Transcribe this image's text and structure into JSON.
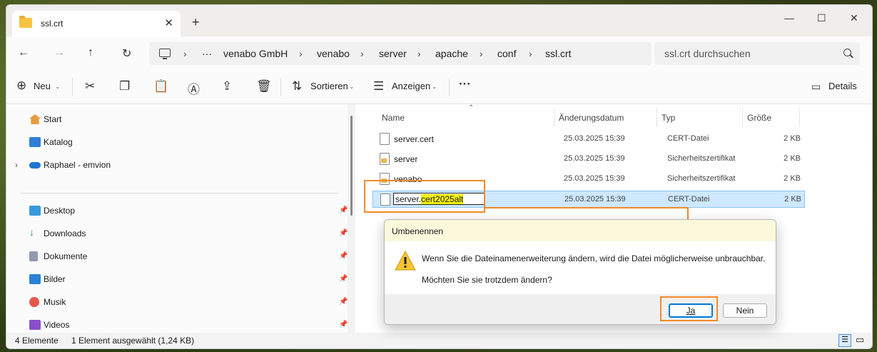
{
  "window": {
    "tab_title": "ssl.crt",
    "close_tab": "✕",
    "new_tab": "+",
    "minimize": "—",
    "maximize": "☐",
    "close": "✕"
  },
  "nav": {
    "back": "←",
    "forward": "→",
    "up": "↑",
    "refresh": "↻",
    "more": "···",
    "breadcrumbs": [
      "venabo GmbH",
      "venabo",
      "server",
      "apache",
      "conf",
      "ssl.crt"
    ],
    "search_placeholder": "ssl.crt durchsuchen"
  },
  "toolbar": {
    "new_label": "Neu",
    "sort_label": "Sortieren",
    "view_label": "Anzeigen",
    "more": "···",
    "details_label": "Details"
  },
  "sidebar": {
    "items": [
      {
        "label": "Start",
        "icon": "home-icon"
      },
      {
        "label": "Katalog",
        "icon": "gallery-icon"
      },
      {
        "label": "Raphael - emvion",
        "icon": "cloud-icon"
      },
      {
        "label": "Desktop",
        "icon": "desktop-icon"
      },
      {
        "label": "Downloads",
        "icon": "download-icon"
      },
      {
        "label": "Dokumente",
        "icon": "documents-icon"
      },
      {
        "label": "Bilder",
        "icon": "pictures-icon"
      },
      {
        "label": "Musik",
        "icon": "music-icon"
      },
      {
        "label": "Videos",
        "icon": "videos-icon"
      }
    ]
  },
  "list": {
    "headers": [
      "Name",
      "Änderungsdatum",
      "Typ",
      "Größe"
    ],
    "rows": [
      {
        "name": "server.cert",
        "date": "25.03.2025 15:39",
        "type": "CERT-Datei",
        "size": "2 KB"
      },
      {
        "name": "server",
        "date": "25.03.2025 15:39",
        "type": "Sicherheitszertifikat",
        "size": "2 KB"
      },
      {
        "name": "venabo",
        "date": "25.03.2025 15:39",
        "type": "Sicherheitszertifikat",
        "size": "2 KB"
      }
    ],
    "selected": {
      "rename_base": "server.",
      "rename_ext": "cert2025alt",
      "date": "25.03.2025 15:39",
      "type": "CERT-Datei",
      "size": "2 KB"
    }
  },
  "status": {
    "count": "4 Elemente",
    "selection": "1 Element ausgewählt (1,24 KB)"
  },
  "dialog": {
    "title": "Umbenennen",
    "message": "Wenn Sie die Dateinamenerweiterung ändern, wird die Datei möglicherweise unbrauchbar.",
    "question": "Möchten Sie sie trotzdem ändern?",
    "yes_label": "Ja",
    "no_label": "Nein"
  },
  "colors": {
    "highlight": "#f28a2c",
    "selection": "#cde8ff",
    "rename_highlight": "#f6f200"
  }
}
